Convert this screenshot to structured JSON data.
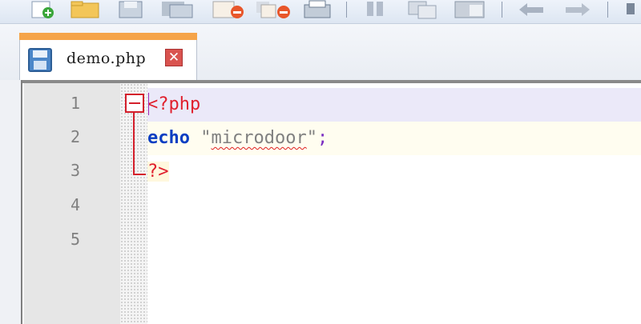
{
  "toolbar": {
    "buttons": [
      {
        "icon": "new-file-icon"
      },
      {
        "icon": "open-file-icon"
      },
      {
        "icon": "save-icon"
      },
      {
        "icon": "save-all-icon"
      },
      {
        "icon": "close-icon"
      },
      {
        "icon": "close-all-icon"
      },
      {
        "icon": "print-icon"
      },
      {
        "icon": "cut-icon"
      },
      {
        "icon": "copy-icon"
      },
      {
        "icon": "paste-icon"
      },
      {
        "icon": "undo-icon"
      },
      {
        "icon": "redo-icon"
      },
      {
        "icon": "find-icon"
      }
    ]
  },
  "tab": {
    "title": "demo.php",
    "close_symbol": "✕",
    "accent": "#f5a449"
  },
  "editor": {
    "line_numbers": [
      "1",
      "2",
      "3",
      "4",
      "5"
    ],
    "code": {
      "line1": "<?php",
      "line2_keyword": "echo",
      "line2_space": " ",
      "line2_quote_open": "\"",
      "line2_string": "microdoor",
      "line2_quote_close": "\"",
      "line2_semicolon": ";",
      "line3": "?>"
    },
    "colors": {
      "php_tag": "#e0202e",
      "keyword": "#0a3ec2",
      "string": "#808080",
      "operator": "#7a2cc2",
      "fold_marker": "#d41f2b",
      "current_line": "#ebe9f9"
    }
  }
}
